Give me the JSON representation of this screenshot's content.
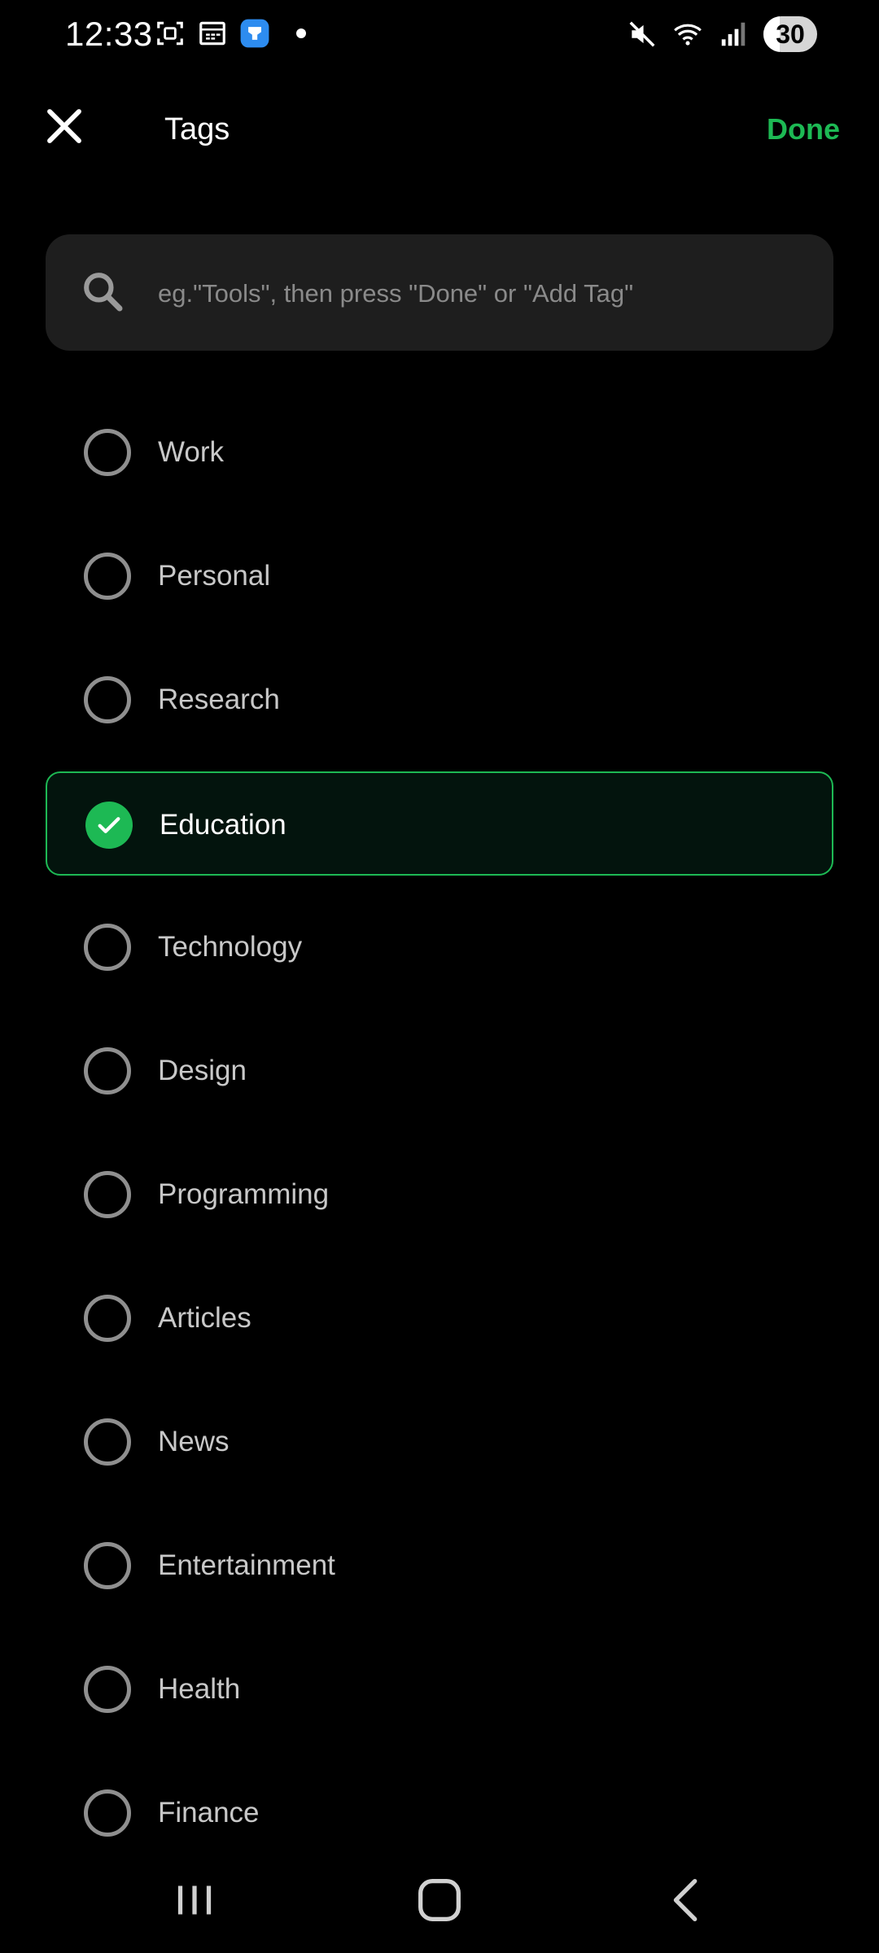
{
  "status_bar": {
    "time": "12:33",
    "left_icons": [
      "screenshot-icon",
      "calendar-icon",
      "app-badge-icon",
      "notification-dot"
    ],
    "right_icons": [
      "mute-icon",
      "wifi-icon",
      "signal-icon"
    ],
    "battery_level": "30"
  },
  "header": {
    "title": "Tags",
    "done_label": "Done",
    "close_icon": "close-icon"
  },
  "search": {
    "placeholder": "eg.\"Tools\", then press \"Done\" or \"Add Tag\"",
    "value": ""
  },
  "tags": [
    {
      "label": "Work",
      "selected": false
    },
    {
      "label": "Personal",
      "selected": false
    },
    {
      "label": "Research",
      "selected": false
    },
    {
      "label": "Education",
      "selected": true
    },
    {
      "label": "Technology",
      "selected": false
    },
    {
      "label": "Design",
      "selected": false
    },
    {
      "label": "Programming",
      "selected": false
    },
    {
      "label": "Articles",
      "selected": false
    },
    {
      "label": "News",
      "selected": false
    },
    {
      "label": "Entertainment",
      "selected": false
    },
    {
      "label": "Health",
      "selected": false
    },
    {
      "label": "Finance",
      "selected": false
    }
  ],
  "nav_bar": {
    "icons": [
      "recents-icon",
      "home-icon",
      "back-icon"
    ]
  },
  "colors": {
    "accent": "#1db954",
    "background": "#000000",
    "search_bg": "#1e1e1e",
    "selected_bg": "#03140d"
  }
}
